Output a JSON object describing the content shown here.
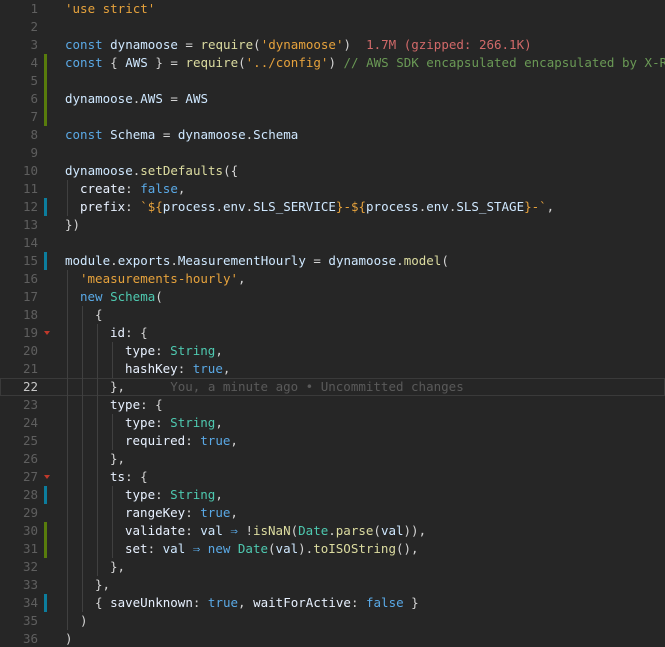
{
  "editor": {
    "language": "javascript",
    "current_line": 22,
    "colors": {
      "background": "#262626",
      "added_marker": "#587c0c",
      "modified_marker": "#0c7d9d"
    },
    "lines": [
      {
        "n": "1",
        "indent": 0,
        "tokens": [
          {
            "c": "str",
            "t": "'use strict'"
          }
        ]
      },
      {
        "n": "2",
        "indent": 0,
        "tokens": []
      },
      {
        "n": "3",
        "indent": 0,
        "tokens": [
          {
            "c": "kw",
            "t": "const "
          },
          {
            "c": "id",
            "t": "dynamoose"
          },
          {
            "c": "pun",
            "t": " = "
          },
          {
            "c": "fn",
            "t": "require"
          },
          {
            "c": "pun",
            "t": "("
          },
          {
            "c": "str",
            "t": "'dynamoose'"
          },
          {
            "c": "pun",
            "t": ")"
          },
          {
            "c": "size",
            "t": "  1.7M (gzipped: 266.1K)"
          }
        ]
      },
      {
        "n": "4",
        "indent": 0,
        "marker": "added",
        "tokens": [
          {
            "c": "kw",
            "t": "const "
          },
          {
            "c": "pun",
            "t": "{ "
          },
          {
            "c": "id",
            "t": "AWS"
          },
          {
            "c": "pun",
            "t": " } = "
          },
          {
            "c": "fn",
            "t": "require"
          },
          {
            "c": "pun",
            "t": "("
          },
          {
            "c": "str",
            "t": "'../config'"
          },
          {
            "c": "pun",
            "t": ") "
          },
          {
            "c": "cmt",
            "t": "// AWS SDK encapsulated encapsulated by X-Ray"
          }
        ]
      },
      {
        "n": "5",
        "indent": 0,
        "marker": "added",
        "tokens": []
      },
      {
        "n": "6",
        "indent": 0,
        "marker": "added",
        "tokens": [
          {
            "c": "id",
            "t": "dynamoose"
          },
          {
            "c": "pun",
            "t": "."
          },
          {
            "c": "id",
            "t": "AWS"
          },
          {
            "c": "pun",
            "t": " = "
          },
          {
            "c": "id",
            "t": "AWS"
          }
        ]
      },
      {
        "n": "7",
        "indent": 0,
        "marker": "added",
        "tokens": []
      },
      {
        "n": "8",
        "indent": 0,
        "tokens": [
          {
            "c": "kw",
            "t": "const "
          },
          {
            "c": "id",
            "t": "Schema"
          },
          {
            "c": "pun",
            "t": " = "
          },
          {
            "c": "id",
            "t": "dynamoose"
          },
          {
            "c": "pun",
            "t": "."
          },
          {
            "c": "id",
            "t": "Schema"
          }
        ]
      },
      {
        "n": "9",
        "indent": 0,
        "tokens": []
      },
      {
        "n": "10",
        "indent": 0,
        "tokens": [
          {
            "c": "id",
            "t": "dynamoose"
          },
          {
            "c": "pun",
            "t": "."
          },
          {
            "c": "fn",
            "t": "setDefaults"
          },
          {
            "c": "pun",
            "t": "({"
          }
        ]
      },
      {
        "n": "11",
        "indent": 1,
        "tokens": [
          {
            "c": "prop",
            "t": "create"
          },
          {
            "c": "pun",
            "t": ": "
          },
          {
            "c": "bool",
            "t": "false"
          },
          {
            "c": "pun",
            "t": ","
          }
        ]
      },
      {
        "n": "12",
        "indent": 1,
        "marker": "modified",
        "tokens": [
          {
            "c": "prop",
            "t": "prefix"
          },
          {
            "c": "pun",
            "t": ": "
          },
          {
            "c": "tpl",
            "t": "`${"
          },
          {
            "c": "id",
            "t": "process"
          },
          {
            "c": "pun",
            "t": "."
          },
          {
            "c": "id",
            "t": "env"
          },
          {
            "c": "pun",
            "t": "."
          },
          {
            "c": "id",
            "t": "SLS_SERVICE"
          },
          {
            "c": "tpl",
            "t": "}-${"
          },
          {
            "c": "id",
            "t": "process"
          },
          {
            "c": "pun",
            "t": "."
          },
          {
            "c": "id",
            "t": "env"
          },
          {
            "c": "pun",
            "t": "."
          },
          {
            "c": "id",
            "t": "SLS_STAGE"
          },
          {
            "c": "tpl",
            "t": "}-`"
          },
          {
            "c": "pun",
            "t": ","
          }
        ]
      },
      {
        "n": "13",
        "indent": 0,
        "tokens": [
          {
            "c": "pun",
            "t": "})"
          }
        ]
      },
      {
        "n": "14",
        "indent": 0,
        "tokens": []
      },
      {
        "n": "15",
        "indent": 0,
        "marker": "modified",
        "tokens": [
          {
            "c": "id",
            "t": "module"
          },
          {
            "c": "pun",
            "t": "."
          },
          {
            "c": "id",
            "t": "exports"
          },
          {
            "c": "pun",
            "t": "."
          },
          {
            "c": "id",
            "t": "MeasurementHourly"
          },
          {
            "c": "pun",
            "t": " = "
          },
          {
            "c": "id",
            "t": "dynamoose"
          },
          {
            "c": "pun",
            "t": "."
          },
          {
            "c": "fn",
            "t": "model"
          },
          {
            "c": "pun",
            "t": "("
          }
        ]
      },
      {
        "n": "16",
        "indent": 1,
        "tokens": [
          {
            "c": "str",
            "t": "'measurements-hourly'"
          },
          {
            "c": "pun",
            "t": ","
          }
        ]
      },
      {
        "n": "17",
        "indent": 1,
        "tokens": [
          {
            "c": "kw",
            "t": "new "
          },
          {
            "c": "type",
            "t": "Schema"
          },
          {
            "c": "pun",
            "t": "("
          }
        ]
      },
      {
        "n": "18",
        "indent": 2,
        "tokens": [
          {
            "c": "pun",
            "t": "{"
          }
        ]
      },
      {
        "n": "19",
        "indent": 3,
        "fold": true,
        "tokens": [
          {
            "c": "prop",
            "t": "id"
          },
          {
            "c": "pun",
            "t": ": {"
          }
        ]
      },
      {
        "n": "20",
        "indent": 4,
        "tokens": [
          {
            "c": "prop",
            "t": "type"
          },
          {
            "c": "pun",
            "t": ": "
          },
          {
            "c": "type",
            "t": "String"
          },
          {
            "c": "pun",
            "t": ","
          }
        ]
      },
      {
        "n": "21",
        "indent": 4,
        "tokens": [
          {
            "c": "prop",
            "t": "hashKey"
          },
          {
            "c": "pun",
            "t": ": "
          },
          {
            "c": "bool",
            "t": "true"
          },
          {
            "c": "pun",
            "t": ","
          }
        ]
      },
      {
        "n": "22",
        "indent": 3,
        "current": true,
        "tokens": [
          {
            "c": "pun",
            "t": "},"
          },
          {
            "c": "blame",
            "t": "      You, a minute ago • Uncommitted changes"
          }
        ]
      },
      {
        "n": "23",
        "indent": 3,
        "tokens": [
          {
            "c": "prop",
            "t": "type"
          },
          {
            "c": "pun",
            "t": ": {"
          }
        ]
      },
      {
        "n": "24",
        "indent": 4,
        "tokens": [
          {
            "c": "prop",
            "t": "type"
          },
          {
            "c": "pun",
            "t": ": "
          },
          {
            "c": "type",
            "t": "String"
          },
          {
            "c": "pun",
            "t": ","
          }
        ]
      },
      {
        "n": "25",
        "indent": 4,
        "tokens": [
          {
            "c": "prop",
            "t": "required"
          },
          {
            "c": "pun",
            "t": ": "
          },
          {
            "c": "bool",
            "t": "true"
          },
          {
            "c": "pun",
            "t": ","
          }
        ]
      },
      {
        "n": "26",
        "indent": 3,
        "tokens": [
          {
            "c": "pun",
            "t": "},"
          }
        ]
      },
      {
        "n": "27",
        "indent": 3,
        "fold": true,
        "tokens": [
          {
            "c": "prop",
            "t": "ts"
          },
          {
            "c": "pun",
            "t": ": {"
          }
        ]
      },
      {
        "n": "28",
        "indent": 4,
        "marker": "modified",
        "tokens": [
          {
            "c": "prop",
            "t": "type"
          },
          {
            "c": "pun",
            "t": ": "
          },
          {
            "c": "type",
            "t": "String"
          },
          {
            "c": "pun",
            "t": ","
          }
        ]
      },
      {
        "n": "29",
        "indent": 4,
        "tokens": [
          {
            "c": "prop",
            "t": "rangeKey"
          },
          {
            "c": "pun",
            "t": ": "
          },
          {
            "c": "bool",
            "t": "true"
          },
          {
            "c": "pun",
            "t": ","
          }
        ]
      },
      {
        "n": "30",
        "indent": 4,
        "marker": "added",
        "tokens": [
          {
            "c": "prop",
            "t": "validate"
          },
          {
            "c": "pun",
            "t": ": "
          },
          {
            "c": "id",
            "t": "val"
          },
          {
            "c": "op",
            "t": " ⇒ "
          },
          {
            "c": "pun",
            "t": "!"
          },
          {
            "c": "fn",
            "t": "isNaN"
          },
          {
            "c": "pun",
            "t": "("
          },
          {
            "c": "type",
            "t": "Date"
          },
          {
            "c": "pun",
            "t": "."
          },
          {
            "c": "fn",
            "t": "parse"
          },
          {
            "c": "pun",
            "t": "("
          },
          {
            "c": "id",
            "t": "val"
          },
          {
            "c": "pun",
            "t": ")),"
          }
        ]
      },
      {
        "n": "31",
        "indent": 4,
        "marker": "added",
        "tokens": [
          {
            "c": "prop",
            "t": "set"
          },
          {
            "c": "pun",
            "t": ": "
          },
          {
            "c": "id",
            "t": "val"
          },
          {
            "c": "op",
            "t": " ⇒ "
          },
          {
            "c": "kw",
            "t": "new "
          },
          {
            "c": "type",
            "t": "Date"
          },
          {
            "c": "pun",
            "t": "("
          },
          {
            "c": "id",
            "t": "val"
          },
          {
            "c": "pun",
            "t": ")."
          },
          {
            "c": "fn",
            "t": "toISOString"
          },
          {
            "c": "pun",
            "t": "(),"
          }
        ]
      },
      {
        "n": "32",
        "indent": 3,
        "tokens": [
          {
            "c": "pun",
            "t": "},"
          }
        ]
      },
      {
        "n": "33",
        "indent": 2,
        "tokens": [
          {
            "c": "pun",
            "t": "},"
          }
        ]
      },
      {
        "n": "34",
        "indent": 2,
        "marker": "modified",
        "tokens": [
          {
            "c": "pun",
            "t": "{ "
          },
          {
            "c": "prop",
            "t": "saveUnknown"
          },
          {
            "c": "pun",
            "t": ": "
          },
          {
            "c": "bool",
            "t": "true"
          },
          {
            "c": "pun",
            "t": ", "
          },
          {
            "c": "prop",
            "t": "waitForActive"
          },
          {
            "c": "pun",
            "t": ": "
          },
          {
            "c": "bool",
            "t": "false"
          },
          {
            "c": "pun",
            "t": " }"
          }
        ]
      },
      {
        "n": "35",
        "indent": 1,
        "tokens": [
          {
            "c": "pun",
            "t": ")"
          }
        ]
      },
      {
        "n": "36",
        "indent": 0,
        "tokens": [
          {
            "c": "pun",
            "t": ")"
          }
        ]
      }
    ]
  }
}
